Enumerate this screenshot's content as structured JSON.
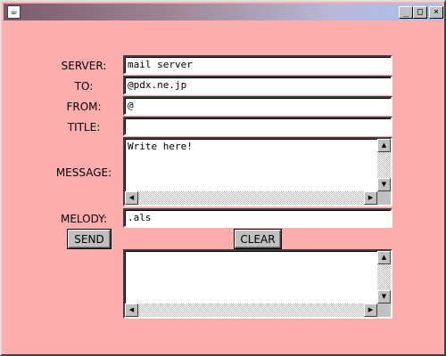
{
  "window": {
    "title": "",
    "app_icon": "java-cup-icon",
    "controls": {
      "minimize": "_",
      "maximize": "□",
      "close": "×"
    }
  },
  "form": {
    "server": {
      "label": "SERVER:",
      "value": "mail server"
    },
    "to": {
      "label": "TO:",
      "value": "@pdx.ne.jp"
    },
    "from": {
      "label": "FROM:",
      "value": "@"
    },
    "title": {
      "label": "TITLE:",
      "value": ""
    },
    "message": {
      "label": "MESSAGE:",
      "value": "Write here!"
    },
    "melody": {
      "label": "MELODY:",
      "value": ".als"
    }
  },
  "buttons": {
    "send": "SEND",
    "clear": "CLEAR"
  },
  "log": {
    "value": ""
  },
  "colors": {
    "background": "#ffaeae",
    "button": "#c0c0c0"
  }
}
